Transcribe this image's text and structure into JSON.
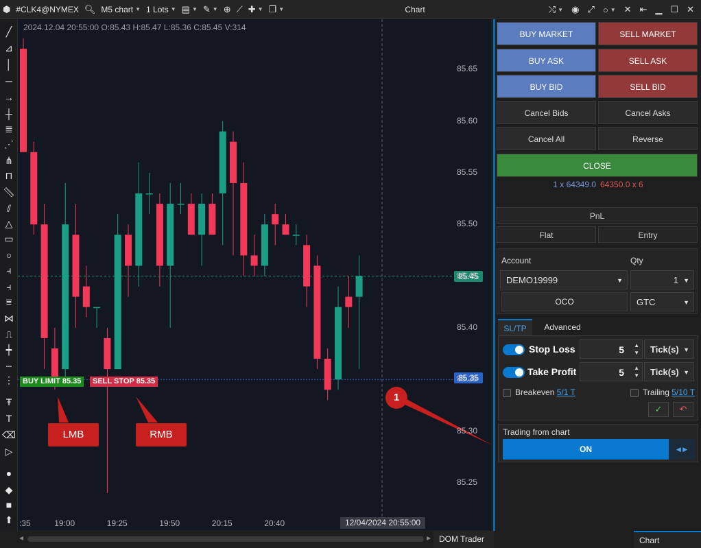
{
  "toolbar": {
    "symbol": "#CLK4@NYMEX",
    "chart_type": "M5 chart",
    "lots": "1 Lots",
    "window_title": "Chart"
  },
  "chart": {
    "ohlc": "2024.12.04 20:55:00 O:85.43 H:85.47 L:85.36 C:85.45 V:314",
    "price_labels": [
      "85.65",
      "85.60",
      "85.55",
      "85.50",
      "85.45",
      "85.40",
      "85.35",
      "85.30",
      "85.25"
    ],
    "time_labels": [
      ":35",
      "19:00",
      "19:25",
      "19:50",
      "20:15",
      "20:40"
    ],
    "last_price_tag": "85.45",
    "order_price_tag": "85.35",
    "crosshair_time": "12/04/2024 20:55:00",
    "buy_limit_label": "BUY LIMIT 85.35",
    "sell_stop_label": "SELL STOP 85.35",
    "callout_lmb": "LMB",
    "callout_rmb": "RMB",
    "marker_label": "1",
    "colors": {
      "up": "#1b9e86",
      "down": "#f2395a",
      "background": "#131722"
    }
  },
  "chart_data": {
    "type": "candlestick",
    "x_labels": [
      ":35",
      "19:00",
      "19:25",
      "19:50",
      "20:15",
      "20:40"
    ],
    "ylim": [
      85.23,
      85.68
    ],
    "candles": [
      {
        "o": 85.67,
        "h": 85.68,
        "l": 85.63,
        "c": 85.57
      },
      {
        "o": 85.57,
        "h": 85.58,
        "l": 85.49,
        "c": 85.5
      },
      {
        "o": 85.5,
        "h": 85.52,
        "l": 85.36,
        "c": 85.39
      },
      {
        "o": 85.38,
        "h": 85.4,
        "l": 85.34,
        "c": 85.35
      },
      {
        "o": 85.36,
        "h": 85.54,
        "l": 85.35,
        "c": 85.5
      },
      {
        "o": 85.49,
        "h": 85.52,
        "l": 85.4,
        "c": 85.43
      },
      {
        "o": 85.44,
        "h": 85.46,
        "l": 85.41,
        "c": 85.42
      },
      {
        "o": 85.42,
        "h": 85.42,
        "l": 85.4,
        "c": 85.42
      },
      {
        "o": 85.39,
        "h": 85.4,
        "l": 85.24,
        "c": 85.36
      },
      {
        "o": 85.36,
        "h": 85.51,
        "l": 85.36,
        "c": 85.49
      },
      {
        "o": 85.49,
        "h": 85.5,
        "l": 85.43,
        "c": 85.46
      },
      {
        "o": 85.46,
        "h": 85.56,
        "l": 85.44,
        "c": 85.53
      },
      {
        "o": 85.53,
        "h": 85.55,
        "l": 85.51,
        "c": 85.53
      },
      {
        "o": 85.52,
        "h": 85.53,
        "l": 85.44,
        "c": 85.46
      },
      {
        "o": 85.46,
        "h": 85.54,
        "l": 85.4,
        "c": 85.52
      },
      {
        "o": 85.52,
        "h": 85.54,
        "l": 85.51,
        "c": 85.52
      },
      {
        "o": 85.52,
        "h": 85.53,
        "l": 85.49,
        "c": 85.49
      },
      {
        "o": 85.49,
        "h": 85.53,
        "l": 85.46,
        "c": 85.52
      },
      {
        "o": 85.52,
        "h": 85.53,
        "l": 85.49,
        "c": 85.49
      },
      {
        "o": 85.53,
        "h": 85.6,
        "l": 85.48,
        "c": 85.59
      },
      {
        "o": 85.58,
        "h": 85.59,
        "l": 85.47,
        "c": 85.54
      },
      {
        "o": 85.54,
        "h": 85.56,
        "l": 85.45,
        "c": 85.47
      },
      {
        "o": 85.47,
        "h": 85.49,
        "l": 85.45,
        "c": 85.46
      },
      {
        "o": 85.46,
        "h": 85.51,
        "l": 85.45,
        "c": 85.5
      },
      {
        "o": 85.51,
        "h": 85.52,
        "l": 85.48,
        "c": 85.5
      },
      {
        "o": 85.5,
        "h": 85.51,
        "l": 85.49,
        "c": 85.49
      },
      {
        "o": 85.49,
        "h": 85.5,
        "l": 85.48,
        "c": 85.49
      },
      {
        "o": 85.48,
        "h": 85.49,
        "l": 85.42,
        "c": 85.44
      },
      {
        "o": 85.46,
        "h": 85.47,
        "l": 85.36,
        "c": 85.37
      },
      {
        "o": 85.37,
        "h": 85.38,
        "l": 85.33,
        "c": 85.34
      },
      {
        "o": 85.35,
        "h": 85.44,
        "l": 85.34,
        "c": 85.42
      },
      {
        "o": 85.43,
        "h": 85.45,
        "l": 85.4,
        "c": 85.42
      },
      {
        "o": 85.43,
        "h": 85.47,
        "l": 85.36,
        "c": 85.45
      }
    ]
  },
  "trader": {
    "buy_market": "BUY MARKET",
    "sell_market": "SELL MARKET",
    "buy_ask": "BUY ASK",
    "sell_ask": "SELL ASK",
    "buy_bid": "BUY BID",
    "sell_bid": "SELL BID",
    "cancel_bids": "Cancel Bids",
    "cancel_asks": "Cancel Asks",
    "cancel_all": "Cancel All",
    "reverse": "Reverse",
    "close": "CLOSE",
    "bid_quote": "1 x 64349.0",
    "ask_quote": "64350.0 x 6",
    "pnl": "PnL",
    "flat": "Flat",
    "entry": "Entry",
    "account_label": "Account",
    "qty_label": "Qty",
    "account_value": "DEMO19999",
    "qty_value": "1",
    "oco": "OCO",
    "tif_value": "GTC",
    "tab_sltp": "SL/TP",
    "tab_advanced": "Advanced",
    "stop_loss_label": "Stop Loss",
    "stop_loss_value": "5",
    "stop_loss_unit": "Tick(s)",
    "take_profit_label": "Take Profit",
    "take_profit_value": "5",
    "take_profit_unit": "Tick(s)",
    "breakeven_label": "Breakeven",
    "breakeven_value": "5/1 T",
    "trailing_label": "Trailing",
    "trailing_value": "5/10 T",
    "tfc_label": "Trading from chart",
    "tfc_state": "ON"
  },
  "bottom_tabs": {
    "dom_trader": "DOM Trader",
    "chart_trader": "Chart Trader"
  }
}
